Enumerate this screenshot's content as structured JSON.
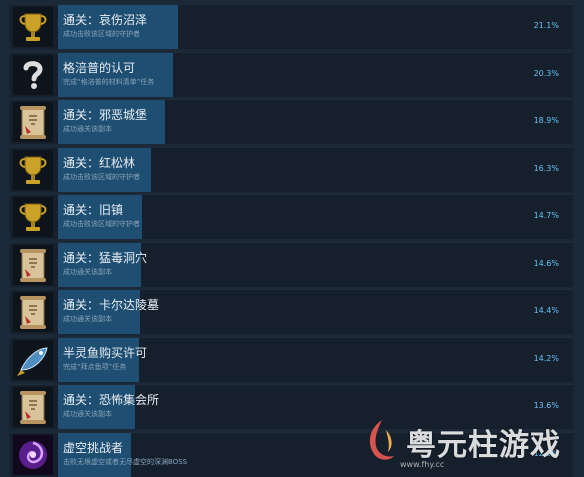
{
  "achievements": [
    {
      "title": "通关：哀伤沼泽",
      "desc": "成功击败该区域的守护者",
      "pct": "21.1%",
      "icon": "trophy-icon",
      "progress": 21.1
    },
    {
      "title": "格涪普的认可",
      "desc": "完成“格涪普的材料清单”任务",
      "pct": "20.3%",
      "icon": "question-mark-icon",
      "progress": 20.3
    },
    {
      "title": "通关：邪恶城堡",
      "desc": "成功通关该副本",
      "pct": "18.9%",
      "icon": "scroll-icon",
      "progress": 18.9
    },
    {
      "title": "通关：红松林",
      "desc": "成功击败该区域的守护者",
      "pct": "16.3%",
      "icon": "trophy-icon",
      "progress": 16.3
    },
    {
      "title": "通关：旧镇",
      "desc": "成功击败该区域的守护者",
      "pct": "14.7%",
      "icon": "trophy-icon",
      "progress": 14.7
    },
    {
      "title": "通关：猛毒洞穴",
      "desc": "成功通关该副本",
      "pct": "14.6%",
      "icon": "scroll-icon",
      "progress": 14.6
    },
    {
      "title": "通关：卡尔达陵墓",
      "desc": "成功通关该副本",
      "pct": "14.4%",
      "icon": "scroll-icon",
      "progress": 14.4
    },
    {
      "title": "半灵鱼购买许可",
      "desc": "完成“拜点鱼项”任务",
      "pct": "14.2%",
      "icon": "fish-icon",
      "progress": 14.2
    },
    {
      "title": "通关：恐怖集会所",
      "desc": "成功通关该副本",
      "pct": "13.6%",
      "icon": "scroll-icon",
      "progress": 13.6
    },
    {
      "title": "虚空挑战者",
      "desc": "击败无垠虚空或者无尽虚空的深渊BOSS",
      "pct": "12.9%",
      "icon": "void-swirl-icon",
      "progress": 12.9
    }
  ],
  "watermark": {
    "text": "粤元柱游戏",
    "url": "www.fhy.cc"
  },
  "colors": {
    "background": "#1b2838",
    "bar": "#1e4e72",
    "percent": "#66c0f4"
  }
}
